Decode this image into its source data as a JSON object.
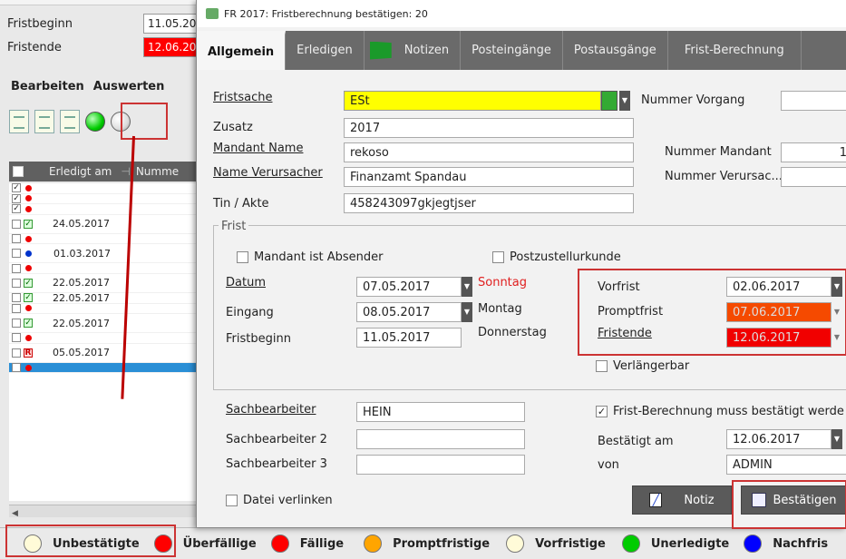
{
  "bg": {
    "fristbeginn_label": "Fristbeginn",
    "fristbeginn_value": "11.05.20",
    "fristende_label": "Fristende",
    "fristende_value": "12.06.20",
    "menu_bearbeiten": "Bearbeiten",
    "menu_auswerten": "Auswerten",
    "grid_header_erledigt": "Erledigt am",
    "grid_header_nummer": "Numme",
    "rows": [
      {
        "date": ""
      },
      {
        "date": ""
      },
      {
        "date": ""
      },
      {
        "date": "24.05.2017"
      },
      {
        "date": ""
      },
      {
        "date": "01.03.2017"
      },
      {
        "date": ""
      },
      {
        "date": "22.05.2017"
      },
      {
        "date": "22.05.2017"
      },
      {
        "date": ""
      },
      {
        "date": "22.05.2017"
      },
      {
        "date": ""
      },
      {
        "date": "05.05.2017"
      },
      {
        "date": ""
      }
    ]
  },
  "legend": {
    "items": [
      {
        "label": "Unbestätigte",
        "color": "#fffbd8"
      },
      {
        "label": "Überfällige",
        "color": "#ff0000"
      },
      {
        "label": "Fällige",
        "color": "#ff0000"
      },
      {
        "label": "Promptfristige",
        "color": "#ffa500"
      },
      {
        "label": "Vorfristige",
        "color": "#fffbd8"
      },
      {
        "label": "Unerledigte",
        "color": "#00cc00"
      },
      {
        "label": "Nachfris",
        "color": "#0000ff"
      }
    ]
  },
  "dialog": {
    "title": "FR 2017: Fristberechnung bestätigen: 20",
    "tabs": [
      "Allgemein",
      "Erledigen",
      "Notizen",
      "Posteingänge",
      "Postausgänge",
      "Frist-Berechnung"
    ],
    "fristsache_label": "Fristsache",
    "fristsache_value": "ESt",
    "nummer_vorgang_label": "Nummer Vorgang",
    "zusatz_label": "Zusatz",
    "zusatz_value": "2017",
    "mandant_name_label": "Mandant Name",
    "mandant_name_value": "rekoso",
    "nummer_mandant_label": "Nummer Mandant",
    "nummer_mandant_value": "1",
    "verursacher_label": "Name Verursacher",
    "verursacher_value": "Finanzamt Spandau",
    "nummer_verursacher_label": "Nummer Verursac...",
    "tin_label": "Tin / Akte",
    "tin_value": "458243097gkjegtjser",
    "frist_group": "Frist",
    "mandant_absender_label": "Mandant ist Absender",
    "postzustellurkunde_label": "Postzustellurkunde",
    "datum_label": "Datum",
    "datum_value": "07.05.2017",
    "datum_day": "Sonntag",
    "eingang_label": "Eingang",
    "eingang_value": "08.05.2017",
    "eingang_day": "Montag",
    "fristbeginn_label": "Fristbeginn",
    "fristbeginn_value": "11.05.2017",
    "fristbeginn_day": "Donnerstag",
    "vorfrist_label": "Vorfrist",
    "vorfrist_value": "02.06.2017",
    "promptfrist_label": "Promptfrist",
    "promptfrist_value": "07.06.2017",
    "fristende_label": "Fristende",
    "fristende_value": "12.06.2017",
    "verlaengerbar_label": "Verlängerbar",
    "sachbearbeiter_label": "Sachbearbeiter",
    "sachbearbeiter_value": "HEIN",
    "sachbearbeiter2_label": "Sachbearbeiter 2",
    "sachbearbeiter3_label": "Sachbearbeiter 3",
    "bestaetigt_check_label": "Frist-Berechnung muss bestätigt werde",
    "bestaetigt_am_label": "Bestätigt am",
    "bestaetigt_am_value": "12.06.2017",
    "von_label": "von",
    "von_value": "ADMIN",
    "datei_verlinken_label": "Datei verlinken",
    "notiz_button": "Notiz",
    "bestaetigen_button": "Bestätigen"
  }
}
